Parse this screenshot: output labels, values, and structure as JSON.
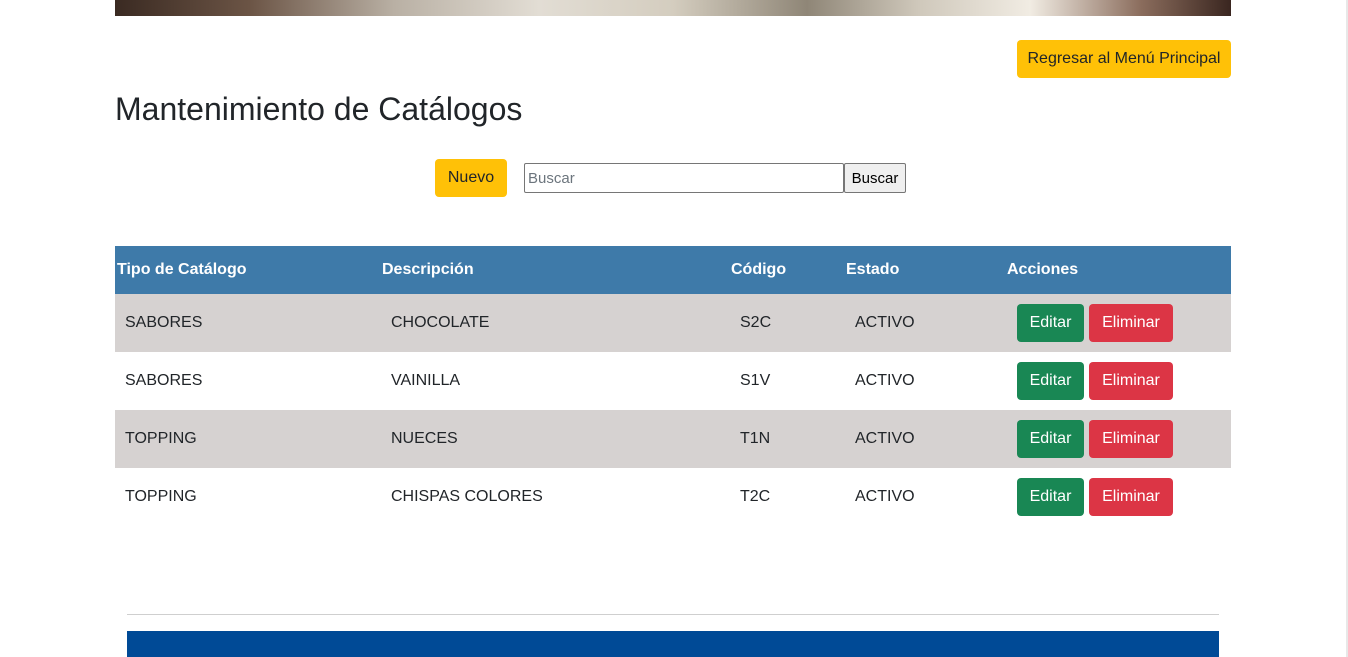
{
  "header": {
    "back_button_label": "Regresar al Menú Principal",
    "title": "Mantenimiento de Catálogos"
  },
  "toolbar": {
    "new_button_label": "Nuevo",
    "search_placeholder": "Buscar",
    "search_value": "",
    "search_button_label": "Buscar"
  },
  "table": {
    "columns": [
      "Tipo de Catálogo",
      "Descripción",
      "Código",
      "Estado",
      "Acciones"
    ],
    "rows": [
      {
        "tipo": "SABORES",
        "descripcion": "CHOCOLATE",
        "codigo": "S2C",
        "estado": "ACTIVO",
        "edit_label": "Editar",
        "delete_label": "Eliminar"
      },
      {
        "tipo": "SABORES",
        "descripcion": "VAINILLA",
        "codigo": "S1V",
        "estado": "ACTIVO",
        "edit_label": "Editar",
        "delete_label": "Eliminar"
      },
      {
        "tipo": "TOPPING",
        "descripcion": "NUECES",
        "codigo": "T1N",
        "estado": "ACTIVO",
        "edit_label": "Editar",
        "delete_label": "Eliminar"
      },
      {
        "tipo": "TOPPING",
        "descripcion": "CHISPAS COLORES",
        "codigo": "T2C",
        "estado": "ACTIVO",
        "edit_label": "Editar",
        "delete_label": "Eliminar"
      }
    ]
  },
  "colors": {
    "accent_yellow": "#ffc107",
    "table_header": "#3e7aa9",
    "row_shade": "#d6d2d1",
    "edit_green": "#198754",
    "delete_red": "#dc3545",
    "footer_blue": "#004a96"
  }
}
